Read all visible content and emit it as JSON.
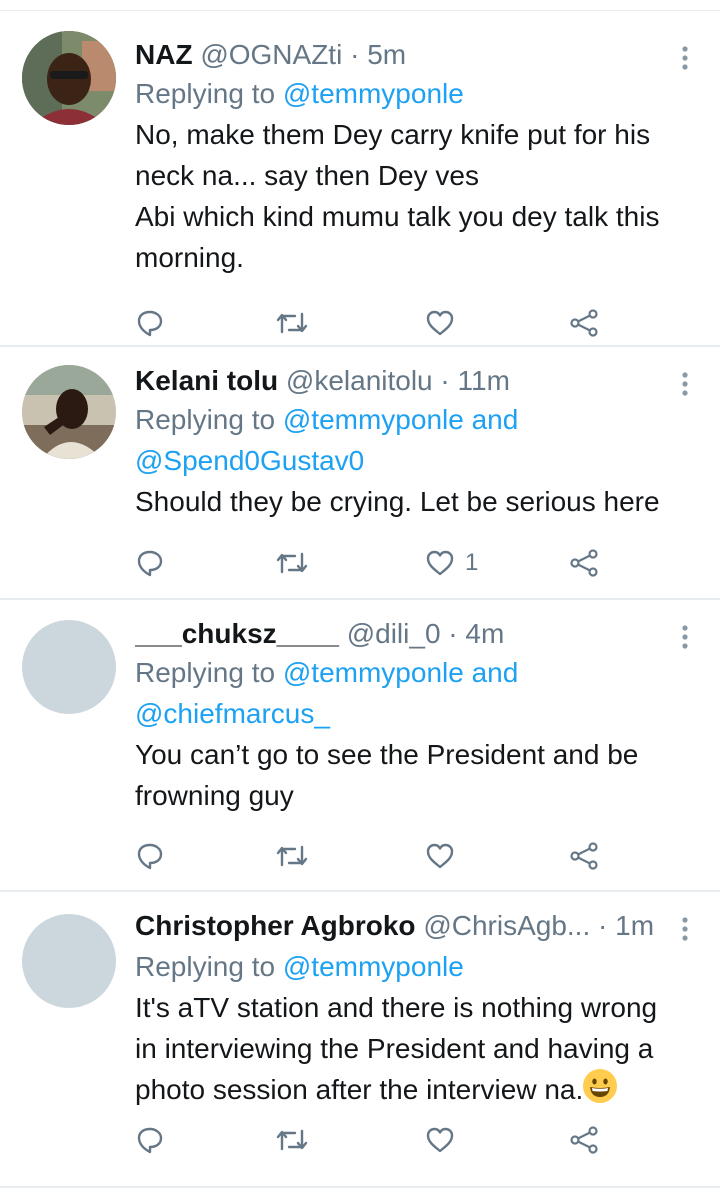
{
  "tweets": [
    {
      "name": "NAZ",
      "handle": "@OGNAZti",
      "time": "5m",
      "replying_prefix": "Replying to ",
      "replying_mentions": "@temmyponle",
      "replying_line2": "",
      "body_lines": [
        "No, make them Dey carry knife put for his",
        "neck na... say then Dey ves",
        "Abi which kind mumu talk you dey talk this",
        "morning."
      ],
      "like_count": "",
      "avatar": "photo"
    },
    {
      "name": "Kelani tolu",
      "handle": "@kelanitolu",
      "time": "11m",
      "replying_prefix": "Replying to ",
      "replying_mentions": "@temmyponle and",
      "replying_line2": "@Spend0Gustav0",
      "body_lines": [
        "Should they be crying. Let be serious here"
      ],
      "like_count": "1",
      "avatar": "photo"
    },
    {
      "name": "___chuksz____",
      "handle": "@dili_0",
      "time": "4m",
      "replying_prefix": "Replying to ",
      "replying_mentions": "@temmyponle and",
      "replying_line2": "@chiefmarcus_",
      "body_lines": [
        "You can’t go to see the President and be",
        "frowning guy"
      ],
      "like_count": "",
      "avatar": "placeholder"
    },
    {
      "name": "Christopher Agbroko",
      "handle": "@ChrisAgb...",
      "time": "1m",
      "replying_prefix": "Replying to ",
      "replying_mentions": "@temmyponle",
      "replying_line2": "",
      "body_lines": [
        "It's aTV station and there is nothing wrong",
        "in interviewing the President and having a",
        "photo session after the interview na."
      ],
      "like_count": "",
      "avatar": "placeholder"
    }
  ],
  "separator": " · ",
  "icons": [
    "reply-icon",
    "retweet-icon",
    "like-icon",
    "share-icon",
    "more-icon"
  ],
  "colors": {
    "text": "#14171a",
    "meta": "#657786",
    "link": "#1da1f2",
    "divider": "#e6ecf0",
    "avatar_placeholder": "#ccd6dd"
  }
}
